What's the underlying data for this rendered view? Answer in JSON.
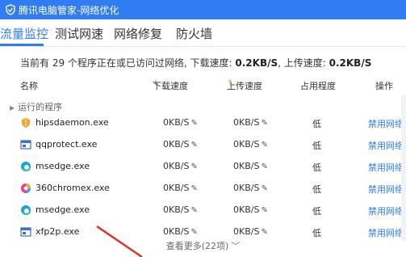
{
  "window": {
    "title": "腾讯电脑管家-网络优化"
  },
  "tabs": [
    {
      "label": "流量监控",
      "active": true
    },
    {
      "label": "测试网速",
      "active": false
    },
    {
      "label": "网络修复",
      "active": false
    },
    {
      "label": "防火墙",
      "active": false
    }
  ],
  "summary": {
    "prefix": "当前有 29 个程序正在或已访问过网络, 下载速度: ",
    "download": "0.2KB/S",
    "mid": ", 上传速度: ",
    "upload": "0.2KB/S"
  },
  "columns": {
    "name": "名称",
    "download": "下载速度",
    "upload": "上传速度",
    "usage": "占用程度",
    "action": "操作"
  },
  "group": {
    "label": "运行的程序"
  },
  "rows": [
    {
      "name": "hipsdaemon.exe",
      "icon": "shield-icon",
      "download": "0KB/S",
      "upload": "0KB/S",
      "usage": "低",
      "action": "禁用网络"
    },
    {
      "name": "qqprotect.exe",
      "icon": "window-icon",
      "download": "0KB/S",
      "upload": "0KB/S",
      "usage": "低",
      "action": "禁用网络"
    },
    {
      "name": "msedge.exe",
      "icon": "edge-icon",
      "download": "0KB/S",
      "upload": "0KB/S",
      "usage": "低",
      "action": "禁用网络"
    },
    {
      "name": "360chromex.exe",
      "icon": "browser-360-icon",
      "download": "0KB/S",
      "upload": "0KB/S",
      "usage": "低",
      "action": "禁用网络"
    },
    {
      "name": "msedge.exe",
      "icon": "edge-icon",
      "download": "0KB/S",
      "upload": "0KB/S",
      "usage": "低",
      "action": "禁用网络"
    },
    {
      "name": "xfp2p.exe",
      "icon": "window-icon",
      "download": "0KB/S",
      "upload": "0KB/S",
      "usage": "低",
      "action": "禁用网络"
    }
  ],
  "more": {
    "label": "查看更多(22项)"
  },
  "colors": {
    "accent": "#2f7cf3",
    "annotation": "#d9342b"
  }
}
